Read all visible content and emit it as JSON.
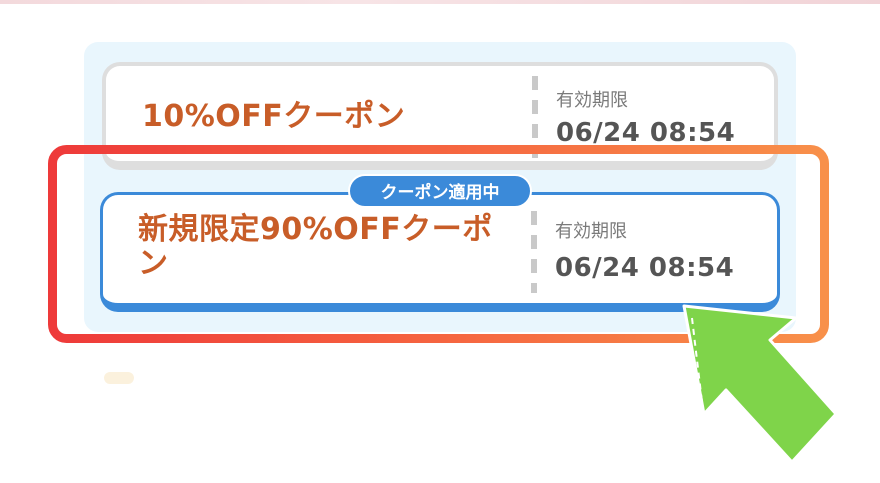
{
  "coupons": [
    {
      "title": "10%OFFクーポン",
      "expiry_label": "有効期限",
      "expiry_value": "06/24 08:54",
      "selected": false
    },
    {
      "title": "新規限定90%OFFクーポン",
      "expiry_label": "有効期限",
      "expiry_value": "06/24 08:54",
      "selected": true
    }
  ],
  "applied_badge": "クーポン適用中",
  "colors": {
    "title": "#c85d28",
    "selected_border": "#3b8ad9",
    "panel_bg": "#e9f6fd",
    "highlight_frame_start": "#ee3a3a",
    "highlight_frame_end": "#f8904a",
    "arrow": "#7fd44a"
  },
  "icons": {
    "pointer": "arrow-pointer-icon"
  }
}
